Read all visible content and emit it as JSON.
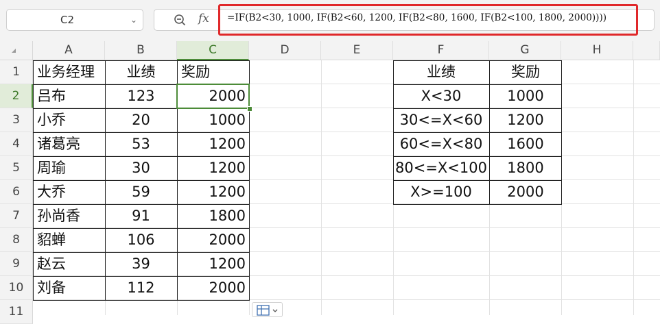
{
  "namebox": {
    "value": "C2"
  },
  "formula_bar": {
    "fx": "fx",
    "formula": "=IF(B2<30, 1000, IF(B2<60, 1200, IF(B2<80, 1600, IF(B2<100, 1800, 2000))))"
  },
  "columns": [
    "A",
    "B",
    "C",
    "D",
    "E",
    "F",
    "G",
    "H"
  ],
  "rows": [
    "1",
    "2",
    "3",
    "4",
    "5",
    "6",
    "7",
    "8",
    "9",
    "10",
    "11"
  ],
  "selected_cell": "C2",
  "main_table": {
    "headers": [
      "业务经理",
      "业绩",
      "奖励"
    ],
    "rows": [
      [
        "吕布",
        "123",
        "2000"
      ],
      [
        "小乔",
        "20",
        "1000"
      ],
      [
        "诸葛亮",
        "53",
        "1200"
      ],
      [
        "周瑜",
        "30",
        "1200"
      ],
      [
        "大乔",
        "59",
        "1200"
      ],
      [
        "孙尚香",
        "91",
        "1800"
      ],
      [
        "貂蝉",
        "106",
        "2000"
      ],
      [
        "赵云",
        "39",
        "1200"
      ],
      [
        "刘备",
        "112",
        "2000"
      ]
    ]
  },
  "lookup_table": {
    "headers": [
      "业绩",
      "奖励"
    ],
    "rows": [
      [
        "X<30",
        "1000"
      ],
      [
        "30<=X<60",
        "1200"
      ],
      [
        "60<=X<80",
        "1600"
      ],
      [
        "80<=X<100",
        "1800"
      ],
      [
        "X>=100",
        "2000"
      ]
    ]
  },
  "colors": {
    "selection": "#4c8b38",
    "highlight": "#e0282a",
    "header_bg": "#f3f3f3"
  },
  "icons": [
    "zoom-icon",
    "chevron-down-icon",
    "quick-analysis-icon"
  ]
}
